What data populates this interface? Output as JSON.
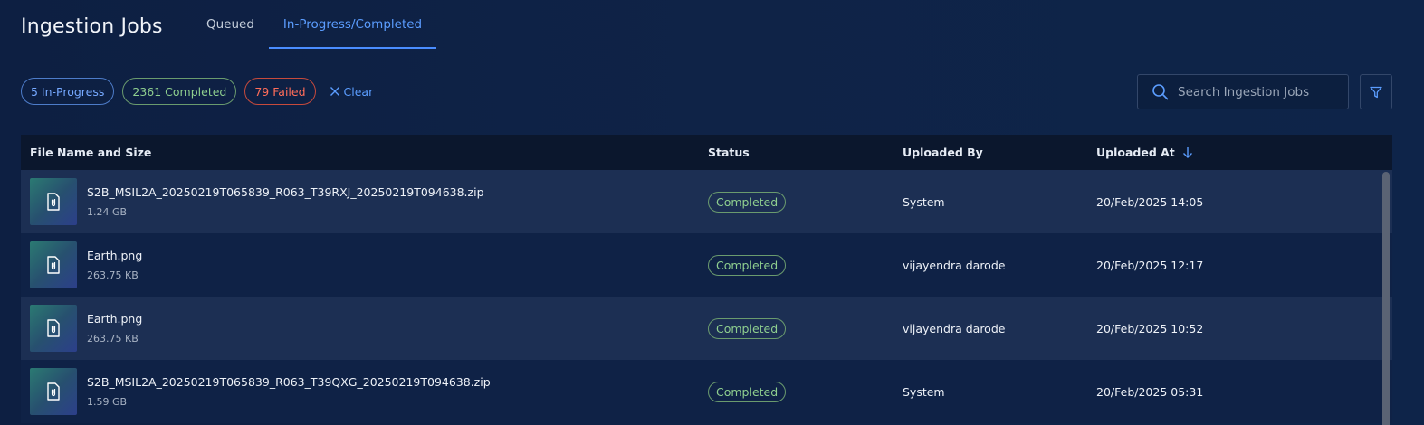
{
  "header": {
    "title": "Ingestion Jobs",
    "tabs": [
      {
        "label": "Queued",
        "active": false
      },
      {
        "label": "In-Progress/Completed",
        "active": true
      }
    ]
  },
  "filters": {
    "in_progress": "5 In-Progress",
    "completed": "2361 Completed",
    "failed": "79 Failed",
    "clear_label": "Clear"
  },
  "search": {
    "placeholder": "Search Ingestion Jobs",
    "value": ""
  },
  "table": {
    "columns": {
      "name": "File Name and Size",
      "status": "Status",
      "uploaded_by": "Uploaded By",
      "uploaded_at": "Uploaded At"
    },
    "sort": {
      "column": "uploaded_at",
      "direction": "desc"
    },
    "rows": [
      {
        "file_name": "S2B_MSIL2A_20250219T065839_R063_T39RXJ_20250219T094638.zip",
        "file_size": "1.24 GB",
        "status": "Completed",
        "uploaded_by": "System",
        "uploaded_at": "20/Feb/2025 14:05"
      },
      {
        "file_name": "Earth.png",
        "file_size": "263.75 KB",
        "status": "Completed",
        "uploaded_by": "vijayendra darode",
        "uploaded_at": "20/Feb/2025 12:17"
      },
      {
        "file_name": "Earth.png",
        "file_size": "263.75 KB",
        "status": "Completed",
        "uploaded_by": "vijayendra darode",
        "uploaded_at": "20/Feb/2025 10:52"
      },
      {
        "file_name": "S2B_MSIL2A_20250219T065839_R063_T39QXG_20250219T094638.zip",
        "file_size": "1.59 GB",
        "status": "Completed",
        "uploaded_by": "System",
        "uploaded_at": "20/Feb/2025 05:31"
      }
    ]
  },
  "colors": {
    "accent": "#5b9dff",
    "in_progress": "#76a9ff",
    "completed": "#8fcf8f",
    "failed": "#ff6d5a",
    "background": "#0f2246",
    "row_alt": "#1c2f53",
    "header_row": "#0b172d"
  },
  "icons": {
    "search": "search-icon",
    "filter": "filter-icon",
    "clear": "close-icon",
    "sort": "arrow-down-icon",
    "file": "attachment-file-icon"
  }
}
